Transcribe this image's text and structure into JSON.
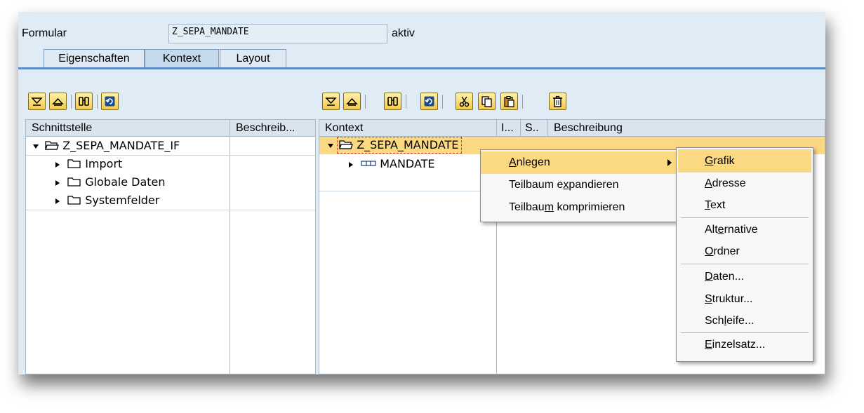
{
  "header": {
    "formular_label": "Formular",
    "formular_value": "Z_SEPA_MANDATE",
    "status": "aktiv"
  },
  "tabs": [
    {
      "label": "Eigenschaften",
      "active": false
    },
    {
      "label": "Kontext",
      "active": true
    },
    {
      "label": "Layout",
      "active": false
    }
  ],
  "left_pane": {
    "col_interface": "Schnittstelle",
    "col_description": "Beschreib...",
    "tree": {
      "root": "Z_SEPA_MANDATE_IF",
      "children": [
        "Import",
        "Globale Daten",
        "Systemfelder"
      ]
    }
  },
  "right_pane": {
    "col_context": "Kontext",
    "col_small1": "I...",
    "col_small2": "S..",
    "col_description": "Beschreibung",
    "tree": {
      "root": "Z_SEPA_MANDATE",
      "children": [
        "MANDATE"
      ]
    }
  },
  "context_menu": {
    "items": [
      {
        "pre": "",
        "u": "A",
        "post": "nlegen",
        "highlighted": true,
        "submenu": true
      },
      {
        "pre": "Teilbaum e",
        "u": "x",
        "post": "pandieren",
        "highlighted": false
      },
      {
        "pre": "Teilbau",
        "u": "m",
        "post": " komprimieren",
        "highlighted": false
      }
    ]
  },
  "submenu": {
    "groups": [
      [
        {
          "pre": "",
          "u": "G",
          "post": "rafik",
          "highlighted": true
        },
        {
          "pre": "",
          "u": "A",
          "post": "dresse"
        },
        {
          "pre": "",
          "u": "T",
          "post": "ext"
        }
      ],
      [
        {
          "pre": "Alt",
          "u": "e",
          "post": "rnative"
        },
        {
          "pre": "",
          "u": "O",
          "post": "rdner"
        }
      ],
      [
        {
          "pre": "",
          "u": "D",
          "post": "aten..."
        },
        {
          "pre": "",
          "u": "S",
          "post": "truktur..."
        },
        {
          "pre": "Sch",
          "u": "l",
          "post": "eife..."
        }
      ],
      [
        {
          "pre": "",
          "u": "E",
          "post": "inzelsatz..."
        }
      ]
    ]
  },
  "colors": {
    "background": "#dfebf5",
    "highlight": "#fbd882",
    "tab_underline": "#5a8cc3"
  }
}
